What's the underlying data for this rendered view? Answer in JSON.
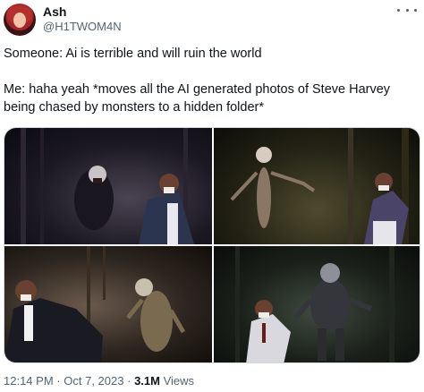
{
  "author": {
    "name": "Ash",
    "handle": "@H1TWOM4N"
  },
  "tweet": {
    "line1": "Someone: Ai is terrible and will ruin the world",
    "line2": "Me: haha yeah *moves all the AI generated photos of Steve Harvey being chased by monsters to a hidden folder*"
  },
  "meta": {
    "time": "12:14 PM",
    "separator": "·",
    "date": "Oct 7, 2023",
    "views_count": "3.1M",
    "views_label": "Views"
  },
  "colors": {
    "text_primary": "#0f1419",
    "text_secondary": "#536471",
    "border": "#cfd9de"
  },
  "icons": {
    "more": "more-horizontal-icon"
  }
}
